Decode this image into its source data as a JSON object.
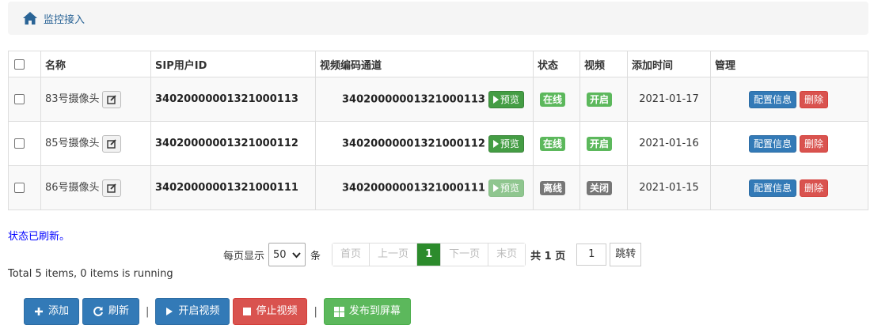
{
  "breadcrumb": {
    "icon": "home-icon",
    "label": "监控接入"
  },
  "table": {
    "headers": [
      "名称",
      "SIP用户ID",
      "视频编码通道",
      "状态",
      "视频",
      "添加时间",
      "管理"
    ],
    "rows": [
      {
        "name": "83号摄像头",
        "sip": "34020000001321000113",
        "encoder": "34020000001321000113",
        "preview": "预览",
        "preview_enabled": true,
        "status": "在线",
        "video": "开启",
        "date": "2021-01-17",
        "config": "配置信息",
        "delete": "删除"
      },
      {
        "name": "85号摄像头",
        "sip": "34020000001321000112",
        "encoder": "34020000001321000112",
        "preview": "预览",
        "preview_enabled": true,
        "status": "在线",
        "video": "开启",
        "date": "2021-01-16",
        "config": "配置信息",
        "delete": "删除"
      },
      {
        "name": "86号摄像头",
        "sip": "34020000001321000111",
        "encoder": "34020000001321000111",
        "preview": "预览",
        "preview_enabled": false,
        "status": "离线",
        "video": "关闭",
        "date": "2021-01-15",
        "config": "配置信息",
        "delete": "删除"
      }
    ]
  },
  "status_message": "状态已刷新。",
  "pagination": {
    "per_page_label": "每页显示",
    "per_page_value": "50",
    "unit": "条",
    "first": "首页",
    "prev": "上一页",
    "current": "1",
    "next": "下一页",
    "last": "末页",
    "total_pages": "共 1 页",
    "jump_value": "1",
    "jump_label": "跳转"
  },
  "total_info": "Total 5 items, 0 items is running",
  "toolbar": {
    "add": "添加",
    "refresh": "刷新",
    "separator": "|",
    "start_video": "开启视频",
    "stop_video": "停止视频",
    "publish": "发布到屏幕"
  },
  "colors": {
    "primary": "#337ab7",
    "danger": "#d9534f",
    "success": "#5cb85c",
    "offline": "#777777",
    "status_text": "#0000ff"
  }
}
